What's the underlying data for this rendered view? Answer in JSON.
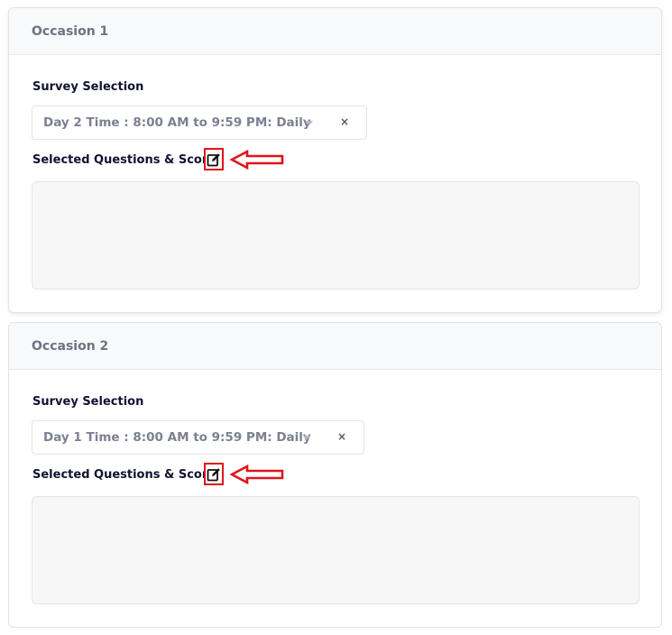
{
  "occasions": [
    {
      "title": "Occasion 1",
      "survey_label": "Survey Selection",
      "survey_value": "Day 2 Time : 8:00 AM to 9:59 PM: Daily",
      "clear_symbol": "×",
      "questions_label": "Selected Questions & Scores",
      "edit_icon": "edit-icon"
    },
    {
      "title": "Occasion 2",
      "survey_label": "Survey Selection",
      "survey_value": "Day 1 Time : 8:00 AM to 9:59 PM: Daily",
      "clear_symbol": "×",
      "questions_label": "Selected Questions & Scores",
      "edit_icon": "edit-icon"
    }
  ],
  "colors": {
    "annotation_red": "#e0141c",
    "header_bg": "#f8f9fb",
    "textarea_bg": "#f7f7f8"
  }
}
